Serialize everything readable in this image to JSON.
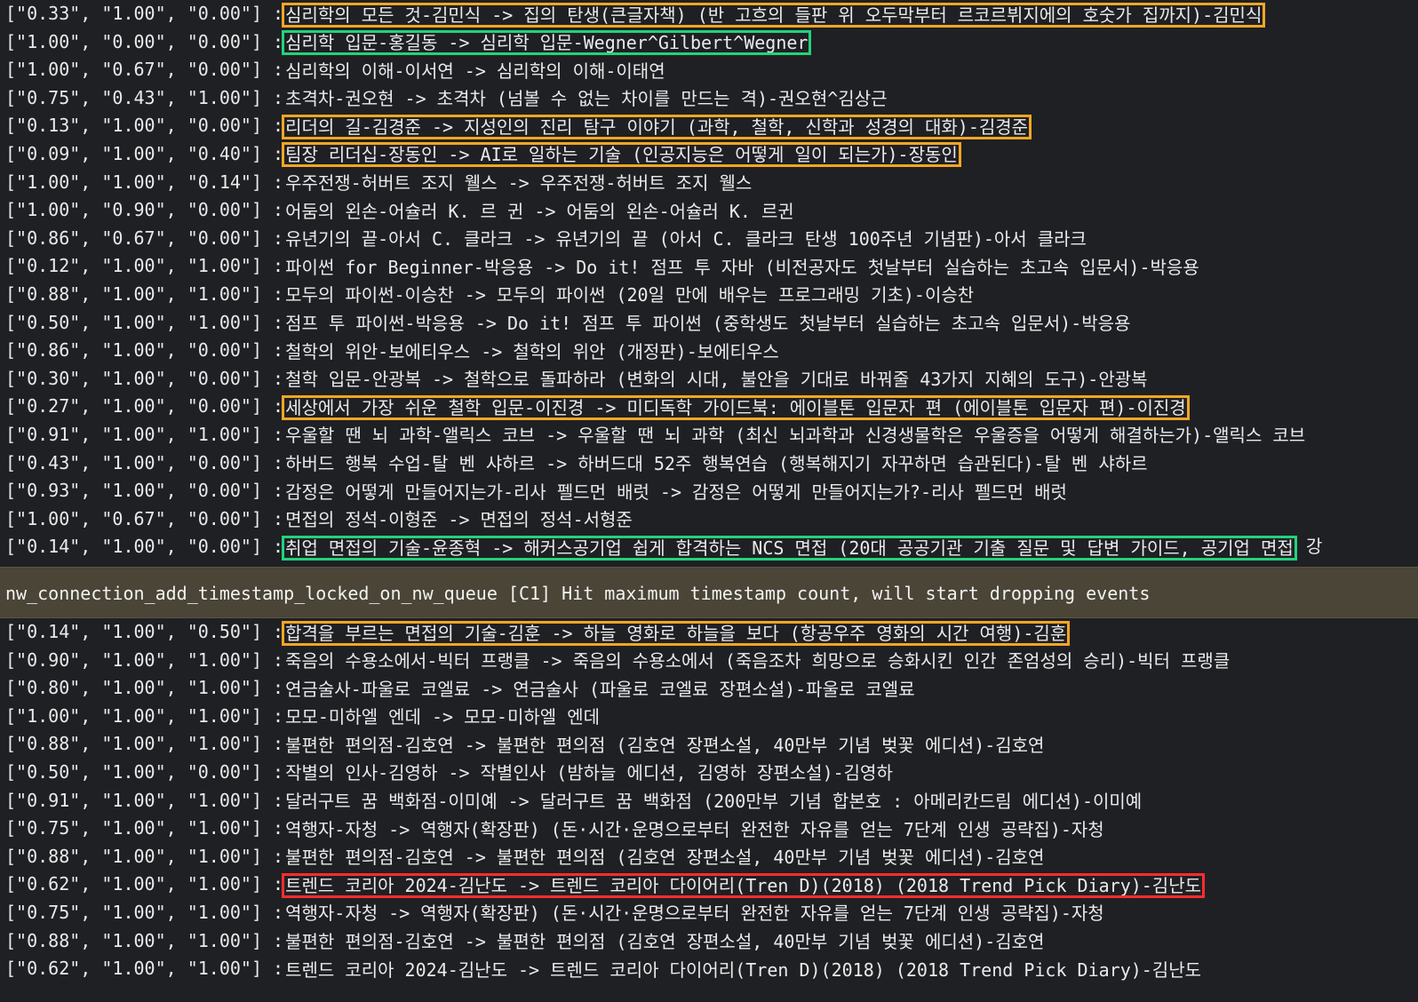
{
  "rows_top": [
    {
      "score": "[\"0.33\", \"1.00\", \"0.00\"] :",
      "text": "심리학의 모든 것-김민식 -> 집의 탄생(큰글자책) (반 고흐의 들판 위 오두막부터 르코르뷔지에의 호숫가 집까지)-김민식",
      "hl": "orange"
    },
    {
      "score": "[\"1.00\", \"0.00\", \"0.00\"] :",
      "text": "심리학 입문-홍길동 -> 심리학 입문-Wegner^Gilbert^Wegner",
      "hl": "green"
    },
    {
      "score": "[\"1.00\", \"0.67\", \"0.00\"] :",
      "text": "심리학의 이해-이서연 -> 심리학의 이해-이태연",
      "hl": ""
    },
    {
      "score": "[\"0.75\", \"0.43\", \"1.00\"] :",
      "text": "초격차-권오현 -> 초격차 (넘볼 수 없는 차이를 만드는 격)-권오현^김상근",
      "hl": ""
    },
    {
      "score": "[\"0.13\", \"1.00\", \"0.00\"] :",
      "text": "리더의 길-김경준 -> 지성인의 진리 탐구 이야기 (과학, 철학, 신학과 성경의 대화)-김경준",
      "hl": "orange"
    },
    {
      "score": "[\"0.09\", \"1.00\", \"0.40\"] :",
      "text": "팀장 리더십-장동인 -> AI로 일하는 기술 (인공지능은 어떻게 일이 되는가)-장동인",
      "hl": "orange"
    },
    {
      "score": "[\"1.00\", \"1.00\", \"0.14\"] :",
      "text": "우주전쟁-허버트 조지 웰스 -> 우주전쟁-허버트 조지 웰스",
      "hl": ""
    },
    {
      "score": "[\"1.00\", \"0.90\", \"0.00\"] :",
      "text": "어둠의 왼손-어슐러 K. 르 귄 -> 어둠의 왼손-어슐러 K. 르귄",
      "hl": ""
    },
    {
      "score": "[\"0.86\", \"0.67\", \"0.00\"] :",
      "text": "유년기의 끝-아서 C. 클라크 -> 유년기의 끝 (아서 C. 클라크 탄생 100주년 기념판)-아서 클라크",
      "hl": ""
    },
    {
      "score": "[\"0.12\", \"1.00\", \"1.00\"] :",
      "text": "파이썬 for Beginner-박응용 -> Do it! 점프 투 자바 (비전공자도 첫날부터 실습하는 초고속 입문서)-박응용",
      "hl": ""
    },
    {
      "score": "[\"0.88\", \"1.00\", \"1.00\"] :",
      "text": "모두의 파이썬-이승찬 -> 모두의 파이썬 (20일 만에 배우는 프로그래밍 기초)-이승찬",
      "hl": ""
    },
    {
      "score": "[\"0.50\", \"1.00\", \"1.00\"] :",
      "text": "점프 투 파이썬-박응용 -> Do it! 점프 투 파이썬 (중학생도 첫날부터 실습하는 초고속 입문서)-박응용",
      "hl": ""
    },
    {
      "score": "[\"0.86\", \"1.00\", \"0.00\"] :",
      "text": "철학의 위안-보에티우스 -> 철학의 위안 (개정판)-보에티우스",
      "hl": ""
    },
    {
      "score": "[\"0.30\", \"1.00\", \"0.00\"] :",
      "text": "철학 입문-안광복 -> 철학으로 돌파하라 (변화의 시대, 불안을 기대로 바꿔줄 43가지 지혜의 도구)-안광복",
      "hl": ""
    },
    {
      "score": "[\"0.27\", \"1.00\", \"0.00\"] :",
      "text": "세상에서 가장 쉬운 철학 입문-이진경 -> 미디독학 가이드북: 에이블톤 입문자 편 (에이블톤 입문자 편)-이진경",
      "hl": "orange"
    },
    {
      "score": "[\"0.91\", \"1.00\", \"1.00\"] :",
      "text": "우울할 땐 뇌 과학-앨릭스 코브 -> 우울할 땐 뇌 과학 (최신 뇌과학과 신경생물학은 우울증을 어떻게 해결하는가)-앨릭스 코브",
      "hl": ""
    },
    {
      "score": "[\"0.43\", \"1.00\", \"0.00\"] :",
      "text": "하버드 행복 수업-탈 벤 샤하르 -> 하버드대 52주 행복연습 (행복해지기 자꾸하면 습관된다)-탈 벤 샤하르",
      "hl": ""
    },
    {
      "score": "[\"0.93\", \"1.00\", \"0.00\"] :",
      "text": "감정은 어떻게 만들어지는가-리사 펠드먼 배럿 -> 감정은 어떻게 만들어지는가?-리사 펠드먼 배럿",
      "hl": ""
    },
    {
      "score": "[\"1.00\", \"0.67\", \"0.00\"] :",
      "text": "면접의 정석-이형준 -> 면접의 정석-서형준",
      "hl": ""
    },
    {
      "score": "[\"0.14\", \"1.00\", \"0.00\"] :",
      "text": "취업 면접의 기술-윤종혁 -> 해커스공기업 쉽게 합격하는 NCS 면접 (20대 공공기관 기출 질문 및 답변 가이드, 공기업 면접",
      "tail": " 강",
      "hl": "green"
    }
  ],
  "warning": "nw_connection_add_timestamp_locked_on_nw_queue [C1] Hit maximum timestamp count, will start dropping events",
  "rows_bottom": [
    {
      "score": "[\"0.14\", \"1.00\", \"0.50\"] :",
      "text": "합격을 부르는 면접의 기술-김훈 -> 하늘 영화로 하늘을 보다 (항공우주 영화의 시간 여행)-김훈",
      "hl": "orange"
    },
    {
      "score": "[\"0.90\", \"1.00\", \"1.00\"] :",
      "text": "죽음의 수용소에서-빅터 프랭클 -> 죽음의 수용소에서 (죽음조차 희망으로 승화시킨 인간 존엄성의 승리)-빅터 프랭클",
      "hl": ""
    },
    {
      "score": "[\"0.80\", \"1.00\", \"1.00\"] :",
      "text": "연금술사-파울로 코엘료 -> 연금술사 (파울로 코엘료 장편소설)-파울로 코엘료",
      "hl": ""
    },
    {
      "score": "[\"1.00\", \"1.00\", \"1.00\"] :",
      "text": "모모-미하엘 엔데 -> 모모-미하엘 엔데",
      "hl": ""
    },
    {
      "score": "[\"0.88\", \"1.00\", \"1.00\"] :",
      "text": "불편한 편의점-김호연 -> 불편한 편의점 (김호연 장편소설, 40만부 기념 벚꽃 에디션)-김호연",
      "hl": ""
    },
    {
      "score": "[\"0.50\", \"1.00\", \"0.00\"] :",
      "text": "작별의 인사-김영하 -> 작별인사 (밤하늘 에디션, 김영하 장편소설)-김영하",
      "hl": ""
    },
    {
      "score": "[\"0.91\", \"1.00\", \"1.00\"] :",
      "text": "달러구트 꿈 백화점-이미예 -> 달러구트 꿈 백화점 (200만부 기념 합본호 : 아메리칸드림 에디션)-이미예",
      "hl": ""
    },
    {
      "score": "[\"0.75\", \"1.00\", \"1.00\"] :",
      "text": "역행자-자청 -> 역행자(확장판) (돈·시간·운명으로부터 완전한 자유를 얻는 7단계 인생 공략집)-자청",
      "hl": ""
    },
    {
      "score": "[\"0.88\", \"1.00\", \"1.00\"] :",
      "text": "불편한 편의점-김호연 -> 불편한 편의점 (김호연 장편소설, 40만부 기념 벚꽃 에디션)-김호연",
      "hl": ""
    },
    {
      "score": "[\"0.62\", \"1.00\", \"1.00\"] :",
      "text": "트렌드 코리아 2024-김난도 -> 트렌드 코리아 다이어리(Tren D)(2018) (2018 Trend Pick Diary)-김난도",
      "hl": "red"
    },
    {
      "score": "[\"0.75\", \"1.00\", \"1.00\"] :",
      "text": "역행자-자청 -> 역행자(확장판) (돈·시간·운명으로부터 완전한 자유를 얻는 7단계 인생 공략집)-자청",
      "hl": ""
    },
    {
      "score": "[\"0.88\", \"1.00\", \"1.00\"] :",
      "text": "불편한 편의점-김호연 -> 불편한 편의점 (김호연 장편소설, 40만부 기념 벚꽃 에디션)-김호연",
      "hl": ""
    },
    {
      "score": "[\"0.62\", \"1.00\", \"1.00\"] :",
      "text": "트렌드 코리아 2024-김난도 -> 트렌드 코리아 다이어리(Tren D)(2018) (2018 Trend Pick Diary)-김난도",
      "hl": ""
    }
  ]
}
